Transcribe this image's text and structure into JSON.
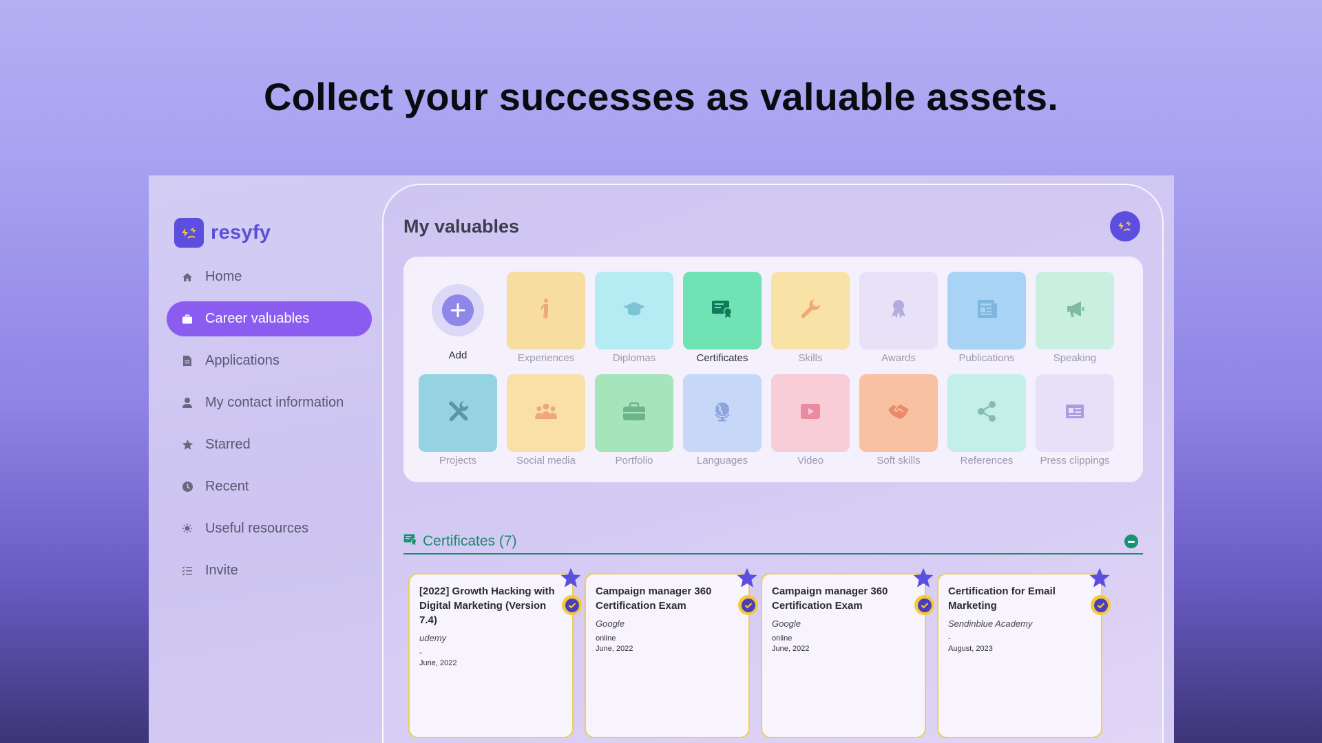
{
  "headline": "Collect your successes as valuable assets.",
  "app": {
    "logo_text": "resyfy",
    "nav": [
      {
        "label": "Home",
        "icon": "home-icon",
        "active": false
      },
      {
        "label": "Career valuables",
        "icon": "briefcase-icon",
        "active": true
      },
      {
        "label": "Applications",
        "icon": "document-icon",
        "active": false
      },
      {
        "label": "My contact information",
        "icon": "person-icon",
        "active": false
      },
      {
        "label": "Starred",
        "icon": "star-icon",
        "active": false
      },
      {
        "label": "Recent",
        "icon": "clock-icon",
        "active": false
      },
      {
        "label": "Useful resources",
        "icon": "lightbulb-icon",
        "active": false
      },
      {
        "label": "Invite",
        "icon": "list-check-icon",
        "active": false
      }
    ],
    "page_title": "My valuables",
    "add_label": "Add",
    "categories": [
      {
        "label": "Experiences",
        "color": "#f7dea0",
        "icon": "person-walking-icon"
      },
      {
        "label": "Diplomas",
        "color": "#b5ecf3",
        "icon": "graduation-cap-icon"
      },
      {
        "label": "Certificates",
        "color": "#6fe3b4",
        "icon": "certificate-icon",
        "selected": true
      },
      {
        "label": "Skills",
        "color": "#f8e2a6",
        "icon": "wrench-icon"
      },
      {
        "label": "Awards",
        "color": "#e7e2f7",
        "icon": "award-icon"
      },
      {
        "label": "Publications",
        "color": "#a8d3f5",
        "icon": "newspaper-icon"
      },
      {
        "label": "Speaking",
        "color": "#c9efe1",
        "icon": "megaphone-icon"
      },
      {
        "label": "Projects",
        "color": "#95d3e2",
        "icon": "tools-icon"
      },
      {
        "label": "Social media",
        "color": "#f8e0a7",
        "icon": "people-icon"
      },
      {
        "label": "Portfolio",
        "color": "#a6e5bc",
        "icon": "briefcase-icon"
      },
      {
        "label": "Languages",
        "color": "#c6d7f8",
        "icon": "globe-icon"
      },
      {
        "label": "Video",
        "color": "#f8cdd8",
        "icon": "play-icon"
      },
      {
        "label": "Soft skills",
        "color": "#f8c2a2",
        "icon": "handshake-icon"
      },
      {
        "label": "References",
        "color": "#c4efe8",
        "icon": "share-icon"
      },
      {
        "label": "Press clippings",
        "color": "#e7e0f8",
        "icon": "id-card-icon"
      }
    ],
    "section": {
      "title": "Certificates (7)",
      "cards": [
        {
          "title": "[2022] Growth Hacking with Digital Marketing (Version 7.4)",
          "issuer": "udemy",
          "location": "-",
          "date": "June, 2022"
        },
        {
          "title": "Campaign manager 360 Certification Exam",
          "issuer": "Google",
          "location": "online",
          "date": "June, 2022"
        },
        {
          "title": "Campaign manager 360 Certification Exam",
          "issuer": "Google",
          "location": "online",
          "date": "June, 2022"
        },
        {
          "title": "Certification for Email Marketing",
          "issuer": "Sendinblue Academy",
          "location": "-",
          "date": "August, 2023"
        }
      ]
    },
    "colors": {
      "accent": "#8a5df0",
      "brand": "#5c4fe0",
      "section": "#1c8a6b",
      "star": "#5c4fe0",
      "badge": "#f4c93a"
    }
  }
}
